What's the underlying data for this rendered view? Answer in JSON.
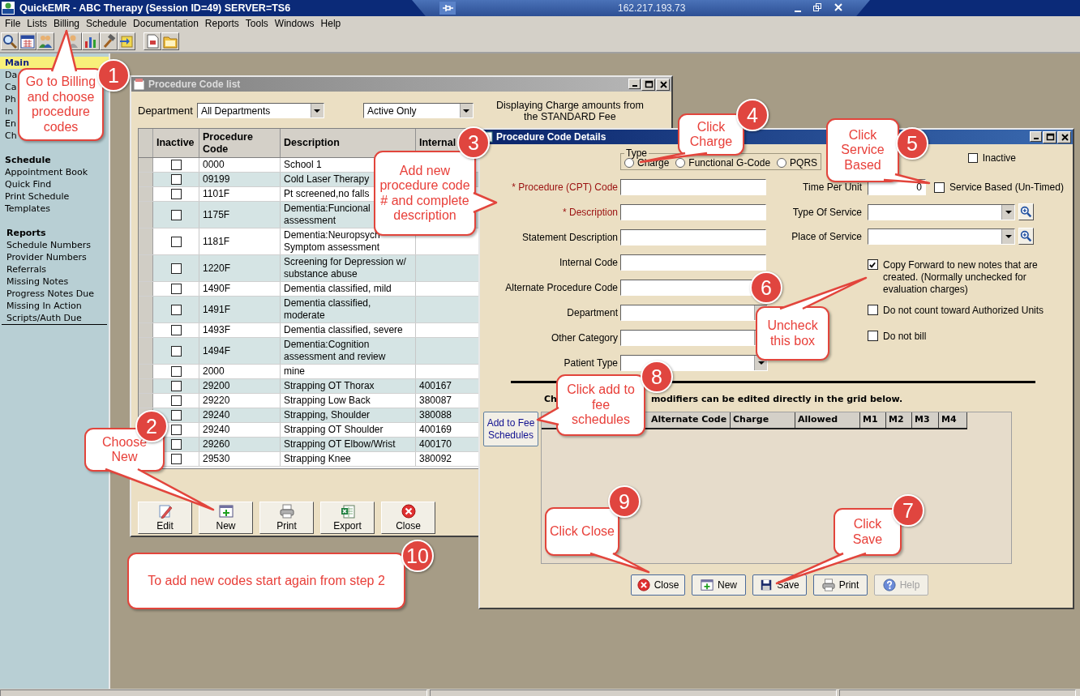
{
  "window": {
    "title": "QuickEMR - ABC Therapy (Session ID=49) SERVER=TS6",
    "remote_address": "162.217.193.73"
  },
  "menu": [
    "File",
    "Lists",
    "Billing",
    "Schedule",
    "Documentation",
    "Reports",
    "Tools",
    "Windows",
    "Help"
  ],
  "sidebar": {
    "sections": [
      {
        "title": "Main",
        "selected": true,
        "items": [
          "Da",
          "Ca",
          "Ph",
          "In",
          "En",
          "Ch"
        ]
      },
      {
        "title": "Schedule",
        "selected": false,
        "items": [
          "Appointment Book",
          "Quick Find",
          "Print Schedule",
          "Templates"
        ]
      },
      {
        "title": "Reports",
        "selected": false,
        "items": [
          "Schedule Numbers",
          "Provider Numbers",
          "Referrals",
          "Missing Notes",
          "Progress Notes Due",
          "Missing In Action",
          "Scripts/Auth Due"
        ]
      }
    ]
  },
  "procedure_list": {
    "title": "Procedure Code list",
    "department_label": "Department",
    "department": "All Departments",
    "status_filter": "Active Only",
    "info": "Displaying Charge amounts from the STANDARD Fee",
    "columns": [
      "Inactive",
      "Procedure Code",
      "Description",
      "Internal"
    ],
    "rows": [
      {
        "inactive": false,
        "code": "0000",
        "description": "School 1"
      },
      {
        "inactive": false,
        "code": "09199",
        "description": "Cold Laser Therapy"
      },
      {
        "inactive": false,
        "code": "1101F",
        "description": "Pt screened,no falls"
      },
      {
        "inactive": false,
        "code": "1175F",
        "description": "Dementia:Funcional assessment"
      },
      {
        "inactive": false,
        "code": "1181F",
        "description": "Dementia:Neuropsych Symptom assessment"
      },
      {
        "inactive": false,
        "code": "1220F",
        "description": "Screening for Depression w/ substance abuse"
      },
      {
        "inactive": false,
        "code": "1490F",
        "description": "Dementia classified, mild"
      },
      {
        "inactive": false,
        "code": "1491F",
        "description": "Dementia classified, moderate"
      },
      {
        "inactive": false,
        "code": "1493F",
        "description": "Dementia classified, severe"
      },
      {
        "inactive": false,
        "code": "1494F",
        "description": "Dementia:Cognition assessment and review"
      },
      {
        "inactive": false,
        "code": "2000",
        "description": "mine"
      },
      {
        "inactive": false,
        "code": "29200",
        "description": "Strapping OT Thorax",
        "internal": "400167"
      },
      {
        "inactive": false,
        "code": "29220",
        "description": "Strapping Low Back",
        "internal": "380087"
      },
      {
        "inactive": false,
        "code": "29240",
        "description": "Strapping, Shoulder",
        "internal": "380088"
      },
      {
        "inactive": false,
        "code": "29240",
        "description": "Strapping OT Shoulder",
        "internal": "400169"
      },
      {
        "inactive": false,
        "code": "29260",
        "description": "Strapping OT Elbow/Wrist",
        "internal": "400170"
      },
      {
        "inactive": false,
        "code": "29530",
        "description": "Strapping Knee",
        "internal": "380092"
      }
    ],
    "buttons": [
      {
        "kind": "edit",
        "label": "Edit"
      },
      {
        "kind": "new",
        "label": "New"
      },
      {
        "kind": "print",
        "label": "Print"
      },
      {
        "kind": "export",
        "label": "Export"
      },
      {
        "kind": "close",
        "label": "Close"
      }
    ]
  },
  "procedure_details": {
    "title": "Procedure Code Details",
    "type": {
      "label": "Type",
      "options": [
        {
          "label": "Charge",
          "selected": false
        },
        {
          "label": "Functional G-Code",
          "selected": false
        },
        {
          "label": "PQRS",
          "selected": false
        }
      ]
    },
    "inactive": {
      "label": "Inactive",
      "checked": false
    },
    "fields": [
      {
        "label": "* Procedure (CPT) Code",
        "required": true,
        "kind": "text"
      },
      {
        "label": "* Description",
        "required": true,
        "kind": "text"
      },
      {
        "label": "Statement Description",
        "required": false,
        "kind": "text"
      },
      {
        "label": "Internal Code",
        "required": false,
        "kind": "text"
      },
      {
        "label": "Alternate Procedure Code",
        "required": false,
        "kind": "text"
      },
      {
        "label": "Department",
        "required": false,
        "kind": "dropdown"
      },
      {
        "label": "Other Category",
        "required": false,
        "kind": "dropdown"
      },
      {
        "label": "Patient Type",
        "required": false,
        "kind": "dropdown"
      }
    ],
    "time_per_unit": {
      "label": "Time Per Unit",
      "value": "0"
    },
    "service_based": {
      "label": "Service Based (Un-Timed)",
      "checked": false
    },
    "lookups": [
      {
        "label": "Type Of Service"
      },
      {
        "label": "Place of Service"
      }
    ],
    "options": [
      {
        "label": "Copy Forward to new notes that are created. (Normally unchecked for evaluation charges)",
        "checked": true
      },
      {
        "label": "Do not count toward Authorized Units",
        "checked": false
      },
      {
        "label": "Do not bill",
        "checked": false
      }
    ],
    "grid_note": [
      "Ch",
      "modifiers can be edited directly in the grid below."
    ],
    "add_button": "Add to Fee Schedules",
    "grid_columns": [
      "Alternate Code",
      "Charge",
      "Allowed",
      "M1",
      "M2",
      "M3",
      "M4"
    ],
    "buttons": [
      {
        "kind": "close",
        "label": "Close",
        "disabled": false
      },
      {
        "kind": "new",
        "label": "New",
        "disabled": false
      },
      {
        "kind": "save",
        "label": "Save",
        "disabled": false
      },
      {
        "kind": "print",
        "label": "Print",
        "disabled": false
      },
      {
        "kind": "help",
        "label": "Help",
        "disabled": true
      }
    ]
  },
  "callouts": [
    {
      "number": "1",
      "text": "Go to Billing and choose procedure codes"
    },
    {
      "number": "2",
      "text": "Choose New"
    },
    {
      "number": "3",
      "text": "Add new procedure code # and complete description"
    },
    {
      "number": "4",
      "text": "Click Charge"
    },
    {
      "number": "5",
      "text": "Click Service Based"
    },
    {
      "number": "6",
      "text": "Uncheck this box"
    },
    {
      "number": "7",
      "text": "Click Save"
    },
    {
      "number": "8",
      "text": "Click add to fee schedules"
    },
    {
      "number": "9",
      "text": "Click Close"
    },
    {
      "number": "10",
      "text": "To add new codes start again from step 2"
    }
  ]
}
